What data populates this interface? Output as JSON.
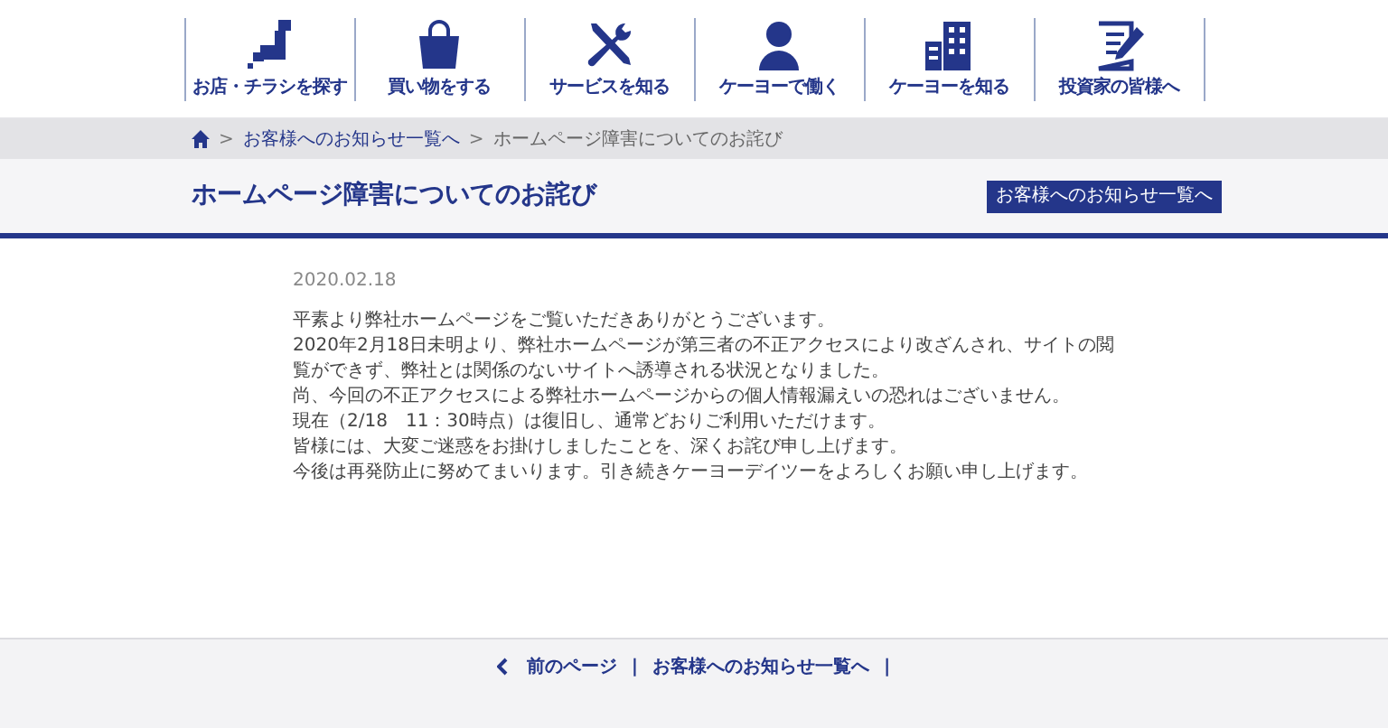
{
  "nav": [
    {
      "label": "お店・チラシを探す",
      "kind": "map"
    },
    {
      "label": "買い物をする",
      "kind": "bag"
    },
    {
      "label": "サービスを知る",
      "kind": "tools"
    },
    {
      "label": "ケーヨーで働く",
      "kind": "person"
    },
    {
      "label": "ケーヨーを知る",
      "kind": "building"
    },
    {
      "label": "投資家の皆様へ",
      "kind": "document"
    }
  ],
  "breadcrumb": [
    {
      "separator": ">",
      "label": "お客様へのお知らせ一覧へ"
    },
    {
      "separator": ">",
      "label": "ホームページ障害についてのお詫び"
    }
  ],
  "title": "ホームページ障害についてのお詫び",
  "list_button": "お客様へのお知らせ一覧へ",
  "date": "2020.02.18",
  "paragraphs": [
    "平素より弊社ホームページをご覧いただきありがとうございます。",
    "2020年2月18日未明より、弊社ホームページが第三者の不正アクセスにより改ざんされ、サイトの閲覧ができず、弊社とは関係のないサイトへ誘導される状況となりました。",
    "尚、今回の不正アクセスによる弊社ホームページからの個人情報漏えいの恐れはございません。",
    "現在（2/18　11：30時点）は復旧し、通常どおりご利用いただけます。",
    "皆様には、大変ご迷惑をお掛けしましたことを、深くお詫び申し上げます。",
    "今後は再発防止に努めてまいります。引き続きケーヨーデイツーをよろしくお願い申し上げます。"
  ],
  "footer": {
    "prev": "前のページ",
    "separators": [
      "|",
      "|"
    ],
    "list_link": "お客様へのお知らせ一覧へ"
  }
}
